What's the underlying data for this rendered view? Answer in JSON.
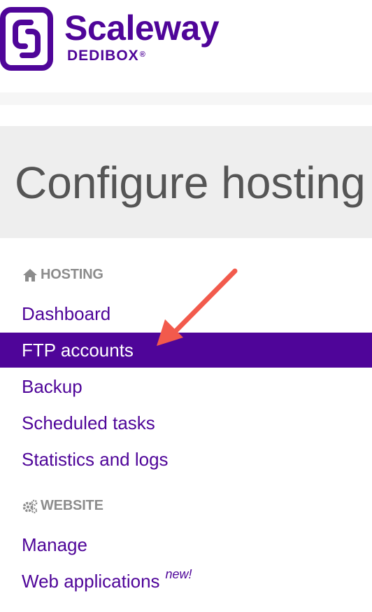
{
  "brand": {
    "name": "Scaleway",
    "product": "DEDIBOX",
    "registered": "®",
    "color": "#4f0599"
  },
  "page": {
    "title": "Configure hosting"
  },
  "nav": {
    "hosting": {
      "heading": "HOSTING",
      "icon": "home-icon",
      "items": [
        "Dashboard",
        "FTP accounts",
        "Backup",
        "Scheduled tasks",
        "Statistics and logs"
      ],
      "active": "FTP accounts"
    },
    "website": {
      "heading": "WEBSITE",
      "icon": "gears-icon",
      "items": [
        "Manage",
        "Web applications"
      ],
      "new_tag": "new!"
    }
  },
  "annotation": {
    "type": "arrow",
    "color": "#f25a4c",
    "points_to": "FTP accounts"
  }
}
